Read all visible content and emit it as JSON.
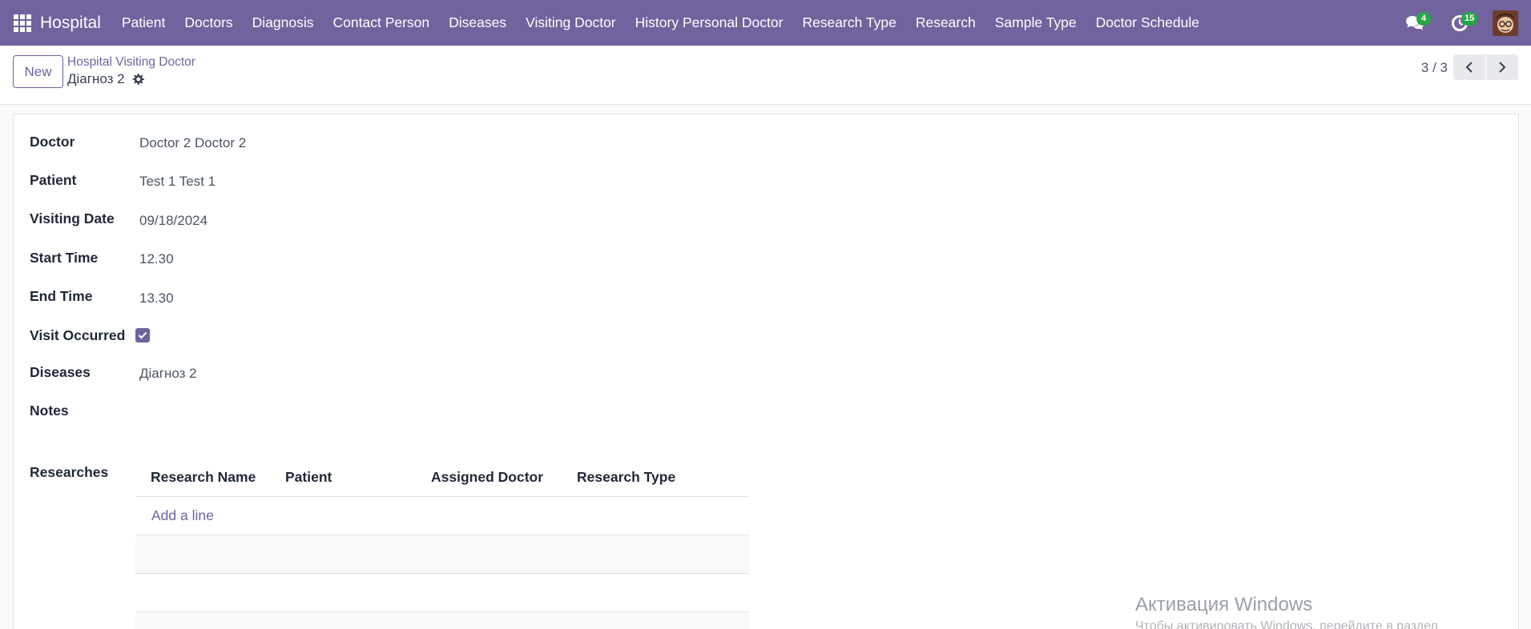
{
  "navbar": {
    "brand": "Hospital",
    "menu": [
      "Patient",
      "Doctors",
      "Diagnosis",
      "Contact Person",
      "Diseases",
      "Visiting Doctor",
      "History Personal Doctor",
      "Research Type",
      "Research",
      "Sample Type",
      "Doctor Schedule"
    ],
    "messages_count": "4",
    "activities_count": "15",
    "accent_color": "#71639e",
    "badge_color": "#28a745"
  },
  "control": {
    "new_label": "New",
    "breadcrumb": "Hospital Visiting Doctor",
    "record_name": "Діагноз 2",
    "pager": "3 / 3"
  },
  "form": {
    "doctor_label": "Doctor",
    "doctor_value": "Doctor 2 Doctor 2",
    "patient_label": "Patient",
    "patient_value": "Test 1 Test 1",
    "visiting_date_label": "Visiting Date",
    "visiting_date_value": "09/18/2024",
    "start_time_label": "Start Time",
    "start_time_value": "12.30",
    "end_time_label": "End Time",
    "end_time_value": "13.30",
    "visit_occurred_label": "Visit Occurred",
    "visit_occurred_value": true,
    "diseases_label": "Diseases",
    "diseases_value": "Діагноз 2",
    "notes_label": "Notes",
    "researches_label": "Researches"
  },
  "researches_table": {
    "columns": [
      "Research Name",
      "Patient",
      "Assigned Doctor",
      "Research Type"
    ],
    "add_line": "Add a line"
  },
  "watermark": {
    "title": "Активация Windows",
    "subtitle": "Чтобы активировать Windows, перейдите в раздел"
  }
}
